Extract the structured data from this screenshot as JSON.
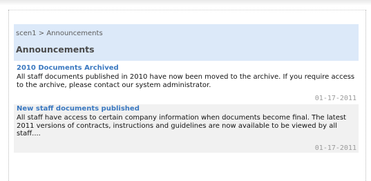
{
  "breadcrumb": {
    "site": "scen1",
    "separator": ">",
    "current": "Announcements"
  },
  "page": {
    "title": "Announcements"
  },
  "announcements": [
    {
      "title": "2010 Documents Archived",
      "body": "All staff documents published in 2010 have now been moved to the archive. If you require access to the archive, please contact our system administrator.",
      "date": "01-17-2011"
    },
    {
      "title": "New staff documents published",
      "body": "All staff have access to certain company information when documents become final. The latest 2011 versions of contracts, instructions and guidelines are now available to be viewed by all staff....",
      "date": "01-17-2011"
    }
  ],
  "colors": {
    "header_bg": "#dce9f9",
    "link": "#3a78c0",
    "alt_row_bg": "#f1f1f1",
    "date_text": "#9a9a9a"
  }
}
